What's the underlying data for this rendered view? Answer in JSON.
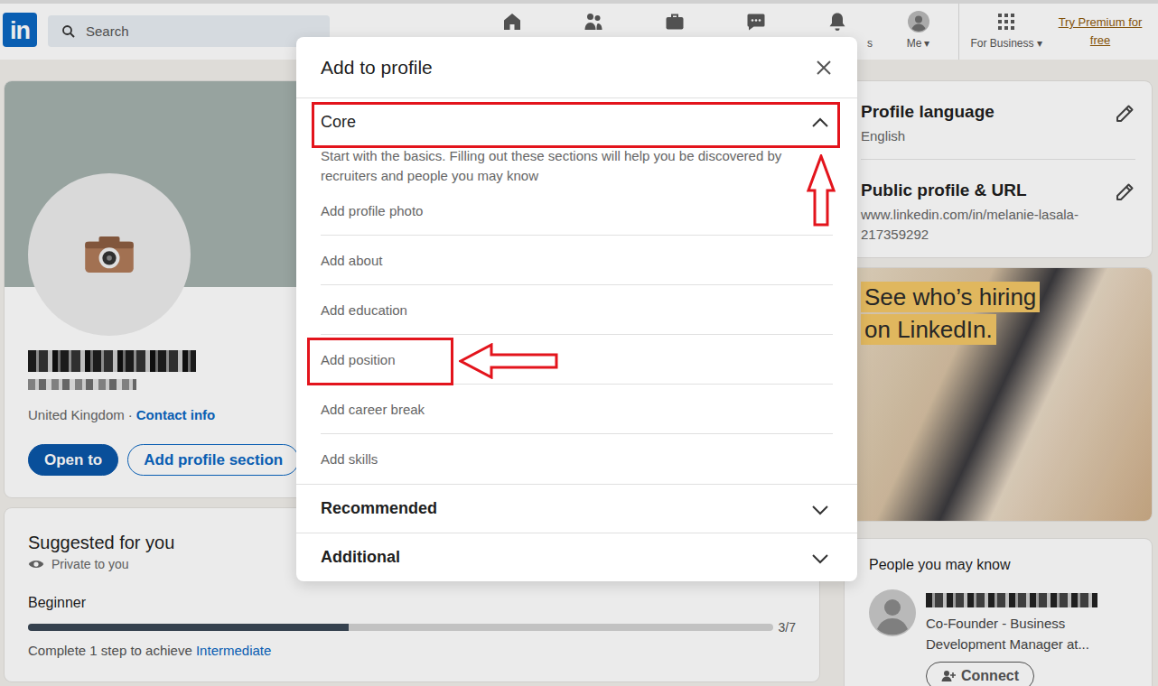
{
  "nav": {
    "logo": "in",
    "search_placeholder": "Search",
    "items": [
      {
        "kind": "home"
      },
      {
        "kind": "network"
      },
      {
        "kind": "jobs"
      },
      {
        "kind": "messaging"
      },
      {
        "kind": "notifications",
        "label": "s"
      }
    ],
    "me": {
      "label": "Me",
      "caret": "▾"
    },
    "business": {
      "label": "For Business",
      "caret": "▾"
    },
    "premium": "Try Premium for free"
  },
  "profile": {
    "name_redacted": true,
    "headline_redacted": true,
    "location": "United Kingdom",
    "separator": "·",
    "contact_link": "Contact info",
    "buttons": [
      {
        "label": "Open to",
        "kind": "primary"
      },
      {
        "label": "Add profile section",
        "kind": "outline"
      }
    ]
  },
  "suggested": {
    "title": "Suggested for you",
    "privacy": "Private to you",
    "stage": "Beginner",
    "level": 0.43,
    "count": "3/7",
    "hint_prefix": "Complete 1 step to achieve ",
    "hint_link": "Intermediate"
  },
  "settings": [
    {
      "title": "Profile language",
      "value": "English"
    },
    {
      "title": "Public profile & URL",
      "value": "www.linkedin.com/in/melanie-lasala-217359292"
    }
  ],
  "ad": {
    "lines": [
      "See who’s hiring",
      "on LinkedIn."
    ]
  },
  "people": {
    "title": "People you may know",
    "items": [
      {
        "name_redacted": true,
        "headline": "Co-Founder - Business Development Manager at...",
        "action": "Connect"
      }
    ]
  },
  "modal": {
    "title": "Add to profile",
    "sections": [
      {
        "title": "Core",
        "expanded": true,
        "highlighted": true,
        "description": "Start with the basics. Filling out these sections will help you be discovered by recruiters and people you may know",
        "items": [
          {
            "label": "Add profile photo",
            "highlighted": false
          },
          {
            "label": "Add about",
            "highlighted": false
          },
          {
            "label": "Add education",
            "highlighted": false
          },
          {
            "label": "Add position",
            "highlighted": true
          },
          {
            "label": "Add career break",
            "highlighted": false
          },
          {
            "label": "Add skills",
            "highlighted": false
          }
        ]
      },
      {
        "title": "Recommended",
        "expanded": false,
        "highlighted": false,
        "items": []
      },
      {
        "title": "Additional",
        "expanded": false,
        "highlighted": false,
        "items": []
      }
    ]
  }
}
